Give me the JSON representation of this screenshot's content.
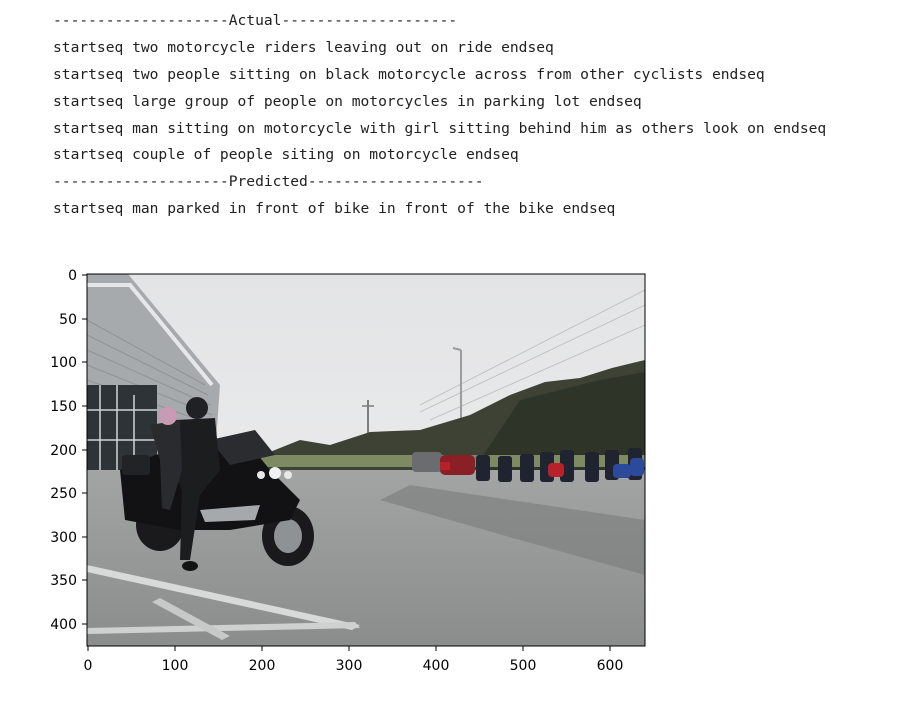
{
  "output": {
    "actual_header": "--------------------Actual--------------------",
    "actual_captions": [
      "startseq two motorcycle riders leaving out on ride endseq",
      "startseq two people sitting on black motorcycle across from other cyclists endseq",
      "startseq large group of people on motorcycles in parking lot endseq",
      "startseq man sitting on motorcycle with girl sitting behind him as others look on endseq",
      "startseq couple of people siting on motorcycle endseq"
    ],
    "predicted_header": "--------------------Predicted--------------------",
    "predicted_caption": "startseq man parked in front of bike in front of the bike endseq"
  },
  "figure": {
    "image_description_icon": "photo-motorcycle-parking-lot",
    "x_ticks": [
      "0",
      "100",
      "200",
      "300",
      "400",
      "500",
      "600"
    ],
    "y_ticks": [
      "0",
      "50",
      "100",
      "150",
      "200",
      "250",
      "300",
      "350",
      "400"
    ],
    "image_width_units": 640,
    "image_height_units": 427
  },
  "colors": {
    "text": "#212121",
    "axis": "#000000",
    "sky": "#e8e9ea",
    "pavement": "#8f9191"
  }
}
